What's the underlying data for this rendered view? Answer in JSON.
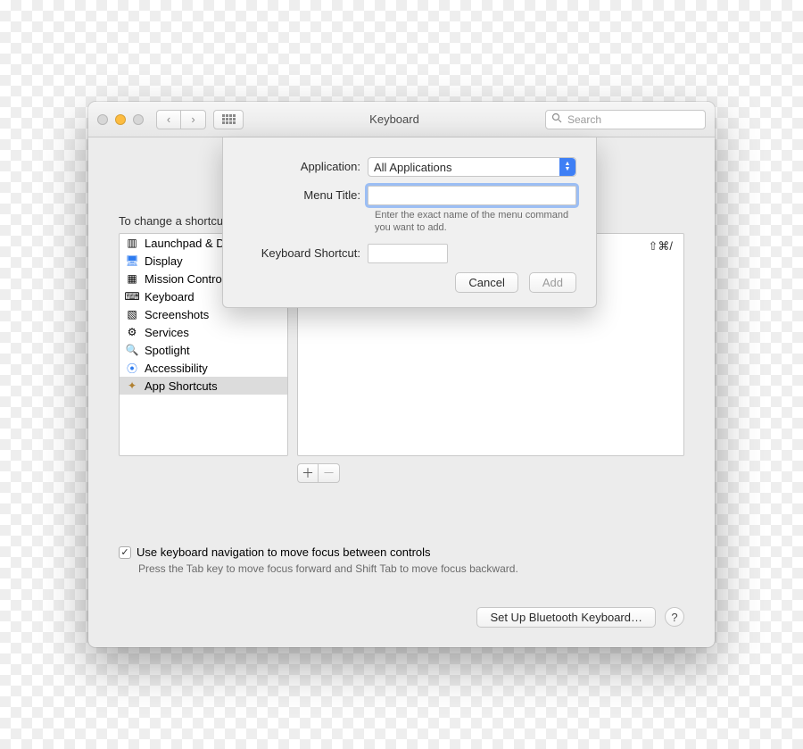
{
  "window": {
    "title": "Keyboard",
    "search_placeholder": "Search"
  },
  "main": {
    "hint": "To change a shortcut, select it, double-click the key combination, then type the new keys.",
    "categories": [
      {
        "label": "Launchpad & Dock",
        "icon": "launchpad"
      },
      {
        "label": "Display",
        "icon": "display"
      },
      {
        "label": "Mission Control",
        "icon": "mission"
      },
      {
        "label": "Keyboard",
        "icon": "keyboard"
      },
      {
        "label": "Screenshots",
        "icon": "screenshot"
      },
      {
        "label": "Services",
        "icon": "services"
      },
      {
        "label": "Spotlight",
        "icon": "spotlight"
      },
      {
        "label": "Accessibility",
        "icon": "accessibility"
      },
      {
        "label": "App Shortcuts",
        "icon": "app-shortcuts",
        "selected": true
      }
    ],
    "shortcut_readout": "⇧⌘/",
    "add_label": "＋",
    "remove_label": "－",
    "nav_checkbox_label": "Use keyboard navigation to move focus between controls",
    "nav_subhint": "Press the Tab key to move focus forward and Shift Tab to move focus backward.",
    "bluetooth_button": "Set Up Bluetooth Keyboard…",
    "help_label": "?"
  },
  "sheet": {
    "application_label": "Application:",
    "application_value": "All Applications",
    "menu_title_label": "Menu Title:",
    "menu_title_value": "",
    "menu_title_helper": "Enter the exact name of the menu command you want to add.",
    "shortcut_label": "Keyboard Shortcut:",
    "shortcut_value": "",
    "cancel_label": "Cancel",
    "add_label": "Add"
  }
}
